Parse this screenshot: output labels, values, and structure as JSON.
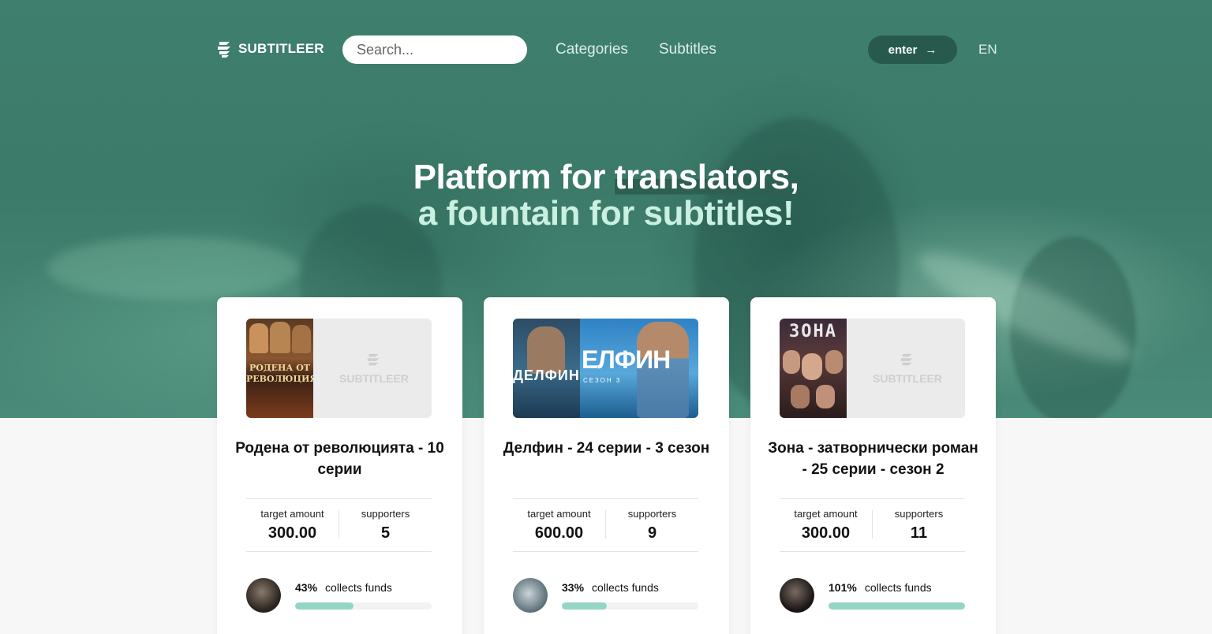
{
  "header": {
    "logo_text": "SUBTITLEER",
    "search_placeholder": "Search...",
    "nav": [
      "Categories",
      "Subtitles"
    ],
    "enter_label": "enter",
    "enter_arrow": "→",
    "language": "EN"
  },
  "hero": {
    "line1_pre": "Platform for ",
    "line1_mark": "translators",
    "line1_post": ",",
    "line2": "a fountain for subtitles!"
  },
  "colors": {
    "accent": "#3c7a69",
    "progress_fill": "#93d6c5",
    "headline_secondary": "#c9f0e1"
  },
  "cards": [
    {
      "title": "Родена от революцията - 10 серии",
      "poster_text": [
        "РОДЕНА ОТ",
        "РЕВОЛЮЦИЯТА"
      ],
      "placeholder_text": "SUBTITLEER",
      "target_label": "target amount",
      "target_value": "300.00",
      "supporters_label": "supporters",
      "supporters_value": "5",
      "percent_text": "43%",
      "percent": 43,
      "status": "collects funds"
    },
    {
      "title": "Делфин - 24 серии - 3 сезон",
      "poster_text": [
        "ДЕЛФИН",
        "ЕЛФИН",
        "СЕЗОН 3"
      ],
      "target_label": "target amount",
      "target_value": "600.00",
      "supporters_label": "supporters",
      "supporters_value": "9",
      "percent_text": "33%",
      "percent": 33,
      "status": "collects funds"
    },
    {
      "title": "Зона - затворнически роман - 25 серии - сезон 2",
      "poster_text": [
        "ЗОНА"
      ],
      "placeholder_text": "SUBTITLEER",
      "target_label": "target amount",
      "target_value": "300.00",
      "supporters_label": "supporters",
      "supporters_value": "11",
      "percent_text": "101%",
      "percent": 101,
      "status": "collects funds"
    }
  ]
}
